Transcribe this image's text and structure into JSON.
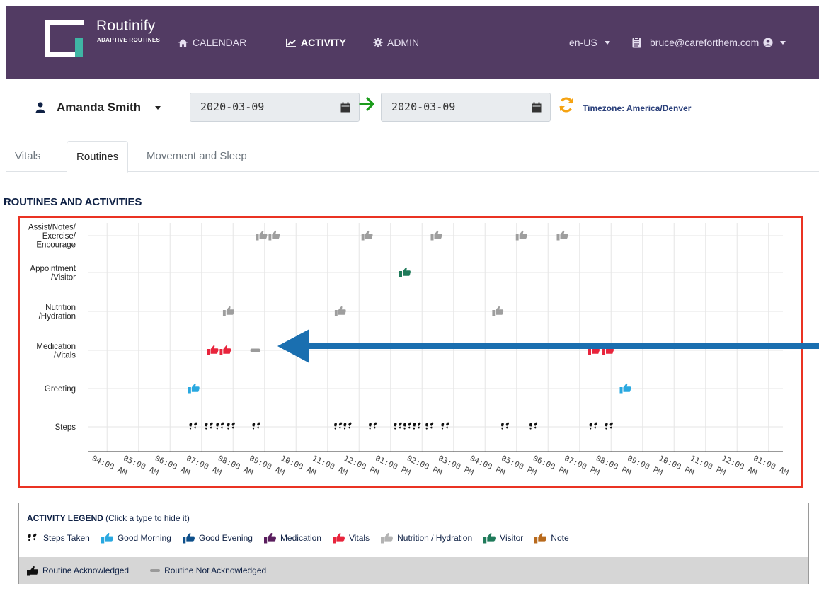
{
  "navbar": {
    "brand_name": "Routinify",
    "brand_sub": "ADAPTIVE ROUTINES",
    "links": [
      {
        "label": "CALENDAR",
        "icon": "home-icon"
      },
      {
        "label": "ACTIVITY",
        "icon": "chart-line-icon",
        "active": true
      },
      {
        "label": "ADMIN",
        "icon": "cog-icon"
      }
    ],
    "locale": "en-US",
    "user_email": "bruce@careforthem.com",
    "color": "#523b63"
  },
  "toolbar": {
    "person": "Amanda Smith",
    "start_date": "2020-03-09",
    "end_date": "2020-03-09",
    "timezone": "Timezone: America/Denver"
  },
  "tabs": [
    {
      "label": "Vitals",
      "active": false
    },
    {
      "label": "Routines",
      "active": true
    },
    {
      "label": "Movement and Sleep",
      "active": false
    }
  ],
  "section_title": "ROUTINES AND ACTIVITIES",
  "chart_data": {
    "type": "scatter",
    "categories": [
      "Assist/Notes/ Exercise/ Encourage",
      "Appointment /Visitor",
      "Nutrition /Hydration",
      "Medication /Vitals",
      "Greeting",
      "Steps"
    ],
    "category_lines": [
      [
        "Assist/Notes/",
        "Exercise/",
        "Encourage"
      ],
      [
        "Appointment",
        "/Visitor"
      ],
      [
        "Nutrition",
        "/Hydration"
      ],
      [
        "Medication",
        "/Vitals"
      ],
      [
        "Greeting"
      ],
      [
        "Steps"
      ]
    ],
    "x_ticks": [
      "04:00 AM",
      "05:00 AM",
      "06:00 AM",
      "07:00 AM",
      "08:00 AM",
      "09:00 AM",
      "10:00 AM",
      "11:00 AM",
      "12:00 PM",
      "01:00 PM",
      "02:00 PM",
      "03:00 PM",
      "04:00 PM",
      "05:00 PM",
      "06:00 PM",
      "07:00 PM",
      "08:00 PM",
      "09:00 PM",
      "10:00 PM",
      "11:00 PM",
      "12:00 AM",
      "01:00 AM"
    ],
    "xlim": [
      4.0,
      26.0
    ],
    "grid": true,
    "series": [
      {
        "name": "Steps Taken",
        "category": "Steps",
        "color": "#111111",
        "icon": "footsteps-icon",
        "x": [
          7.3,
          7.8,
          8.15,
          8.5,
          9.3,
          11.9,
          12.2,
          13.0,
          13.8,
          14.1,
          14.4,
          14.8,
          15.3,
          17.2,
          18.1,
          20.0,
          20.5
        ]
      },
      {
        "name": "Good Morning",
        "category": "Greeting",
        "color": "#29a8e0",
        "icon": "thumbs-up-icon",
        "x": [
          7.3,
          21.0
        ]
      },
      {
        "name": "Vitals",
        "category": "Medication /Vitals",
        "color": "#e8243c",
        "icon": "thumbs-up-icon",
        "x": [
          7.9,
          8.3,
          20.0,
          20.45
        ]
      },
      {
        "name": "Routine Not Acknowledged",
        "category": "Medication /Vitals",
        "color": "#9a9a9a",
        "icon": "dash-icon",
        "x": [
          9.25
        ]
      },
      {
        "name": "Nutrition / Hydration",
        "category": "Nutrition /Hydration",
        "color": "#9e9e9e",
        "icon": "thumbs-up-icon",
        "x": [
          8.4,
          11.95,
          16.95
        ]
      },
      {
        "name": "Visitor",
        "category": "Appointment /Visitor",
        "color": "#1f7a5a",
        "icon": "thumbs-up-icon",
        "x": [
          14.0
        ]
      },
      {
        "name": "Assist/Notes/Exercise/Encourage",
        "category": "Assist/Notes/ Exercise/ Encourage",
        "color": "#9e9e9e",
        "icon": "thumbs-up-icon",
        "x": [
          9.45,
          9.85,
          12.8,
          15.0,
          17.7,
          19.0
        ]
      }
    ]
  },
  "annotation_arrow": {
    "color": "#1a6fb0",
    "icon": "left-arrow-icon"
  },
  "legend": {
    "title_bold": "ACTIVITY LEGEND",
    "title_rest": " (Click a type to hide it)",
    "items": [
      {
        "label": "Steps Taken",
        "icon": "footsteps-icon",
        "color": "#111111"
      },
      {
        "label": "Good Morning",
        "icon": "thumbs-up-icon",
        "color": "#29a8e0"
      },
      {
        "label": "Good Evening",
        "icon": "thumbs-up-icon",
        "color": "#0d4f8a"
      },
      {
        "label": "Medication",
        "icon": "thumbs-up-icon",
        "color": "#5a1e5e"
      },
      {
        "label": "Vitals",
        "icon": "thumbs-up-icon",
        "color": "#e8243c"
      },
      {
        "label": "Nutrition / Hydration",
        "icon": "thumbs-up-icon",
        "color": "#b3b3b3"
      },
      {
        "label": "Visitor",
        "icon": "thumbs-up-icon",
        "color": "#1f7a5a"
      },
      {
        "label": "Note",
        "icon": "thumbs-up-icon",
        "color": "#b86a1d"
      }
    ],
    "footer": [
      {
        "label": "Routine Acknowledged",
        "icon": "thumbs-up-icon",
        "color": "#111111"
      },
      {
        "label": "Routine Not Acknowledged",
        "icon": "dash-icon",
        "color": "#9a9a9a"
      }
    ]
  }
}
